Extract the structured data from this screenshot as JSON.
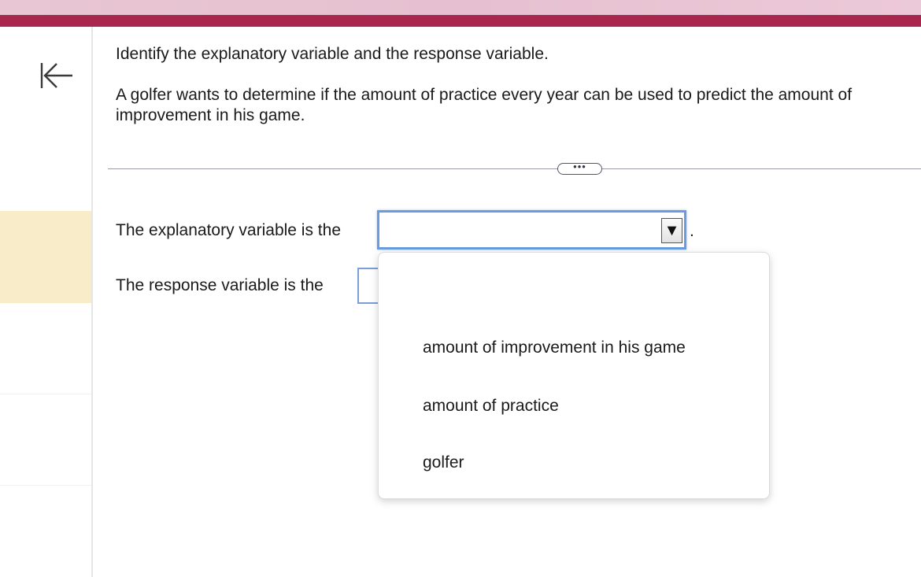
{
  "question": {
    "instruction": "Identify the explanatory variable and the response variable.",
    "scenario": "A golfer wants to determine if the amount of practice every year can be used to predict the amount of improvement in his game."
  },
  "more_button": "•••",
  "explanatory": {
    "label": "The explanatory variable is the",
    "selected": "",
    "suffix": "."
  },
  "response": {
    "label": "The response variable is the",
    "selected": ""
  },
  "dropdown": {
    "blank": "",
    "options": [
      "amount of improvement in his game",
      "amount of practice",
      "golfer"
    ]
  },
  "icons": {
    "collapse": "collapse-left-icon",
    "arrow": "▼"
  },
  "colors": {
    "brand_bar": "#a9264f",
    "header_gradient": "#e8c6d3",
    "sidebar_highlight": "#f8ecc9",
    "focus_border": "#6a9be0"
  }
}
